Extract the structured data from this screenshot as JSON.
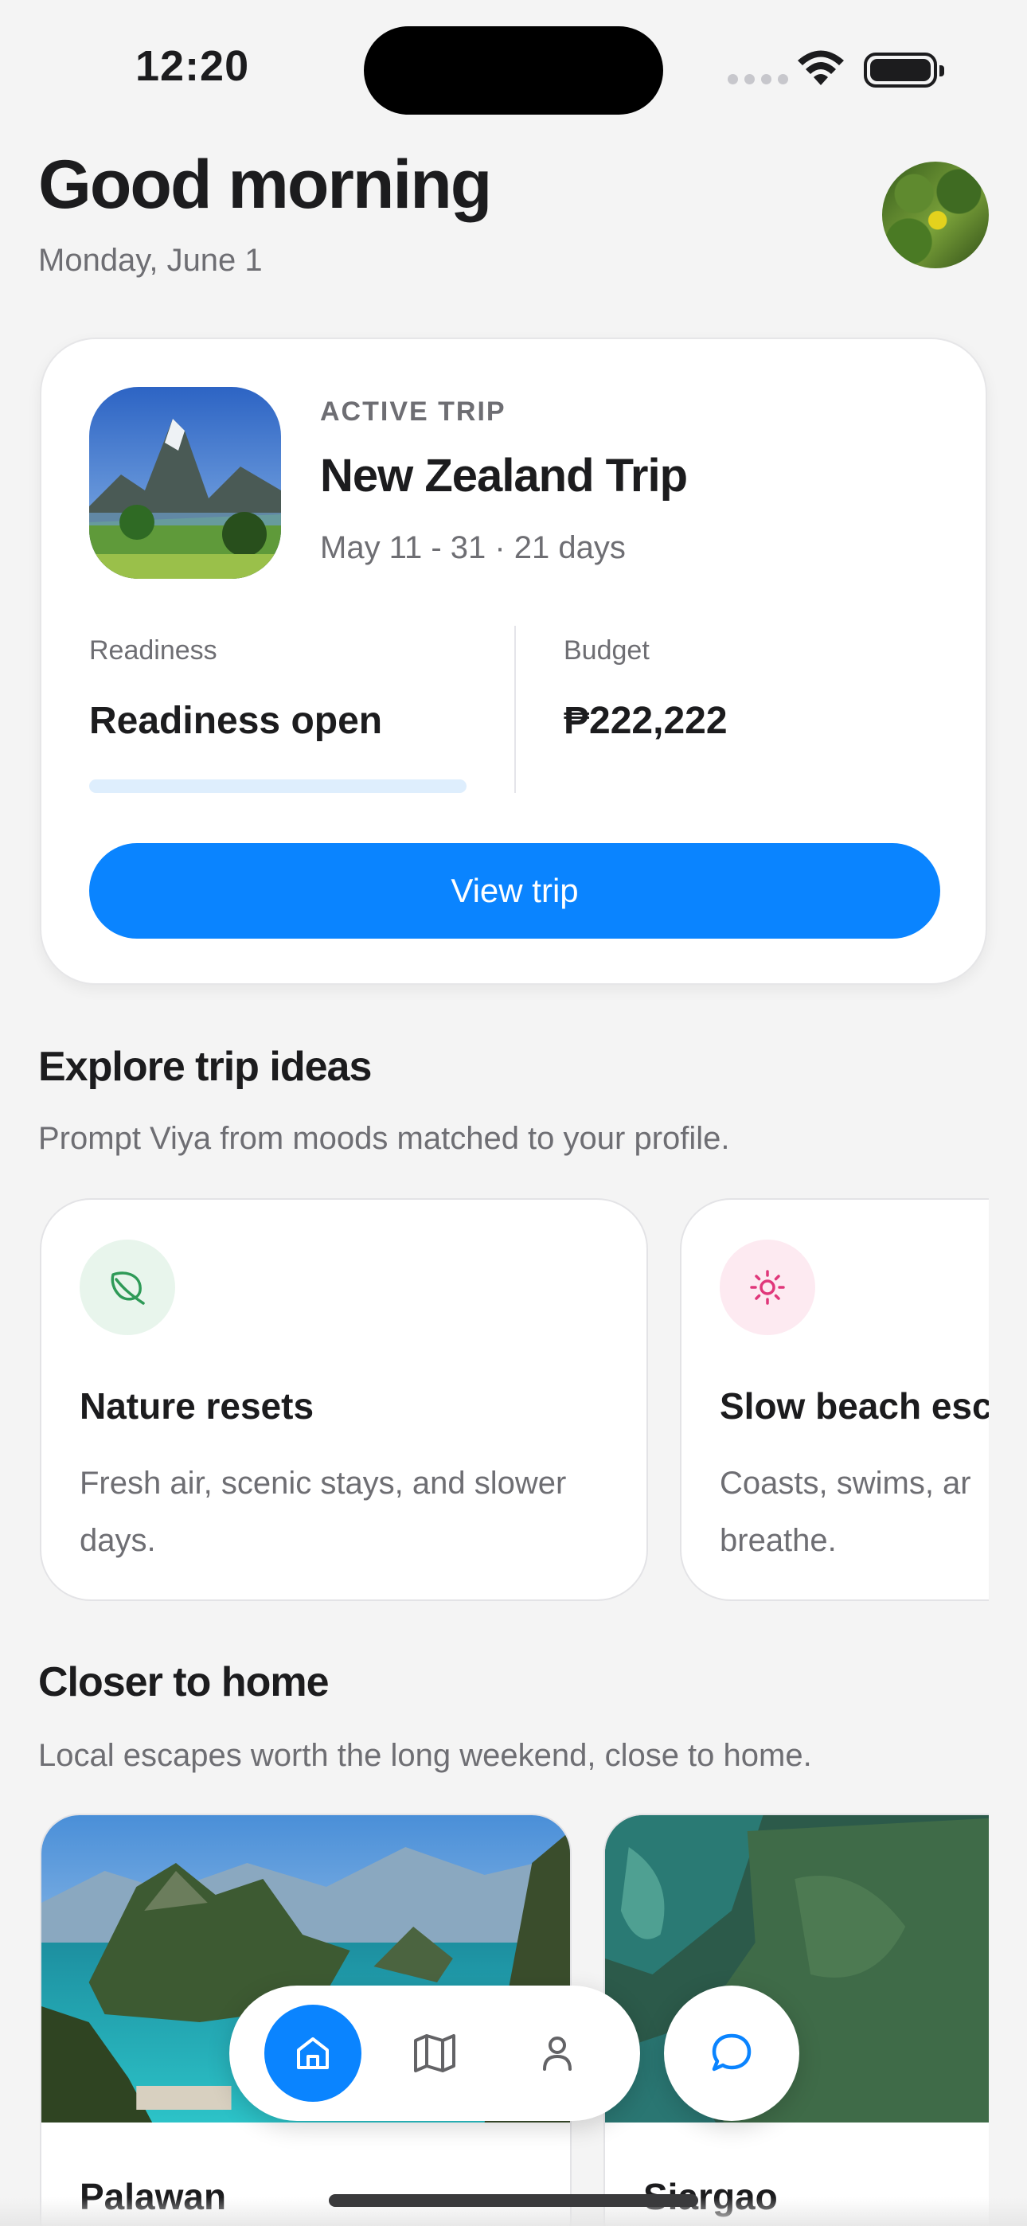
{
  "status_bar": {
    "time": "12:20"
  },
  "header": {
    "greeting": "Good morning",
    "date": "Monday, June 1"
  },
  "trip": {
    "label": "ACTIVE TRIP",
    "title": "New Zealand Trip",
    "dates": "May 11 - 31 · 21 days",
    "readiness_label": "Readiness",
    "readiness_value": "Readiness open",
    "readiness_progress": 0,
    "budget_label": "Budget",
    "budget_value": "₱222,222",
    "button_label": "View trip"
  },
  "ideas": {
    "title": "Explore trip ideas",
    "subtitle": "Prompt Viya from moods matched to your profile.",
    "cards": [
      {
        "title": "Nature resets",
        "desc": "Fresh air, scenic stays, and slower days.",
        "icon": "leaf-icon",
        "accent": "#2e9a57"
      },
      {
        "title": "Slow beach esc",
        "desc": "Coasts, swims, ar breathe.",
        "icon": "sun-icon",
        "accent": "#e0377a"
      }
    ]
  },
  "home": {
    "title": "Closer to home",
    "subtitle": "Local escapes worth the long weekend, close to home.",
    "places": [
      {
        "name": "Palawan"
      },
      {
        "name": "Siargao"
      }
    ]
  },
  "nav": {
    "items": [
      "home-icon",
      "map-icon",
      "profile-icon"
    ],
    "active": "home-icon",
    "chat": "chat-icon"
  },
  "colors": {
    "accent": "#0a84ff",
    "background": "#f4f4f4"
  }
}
